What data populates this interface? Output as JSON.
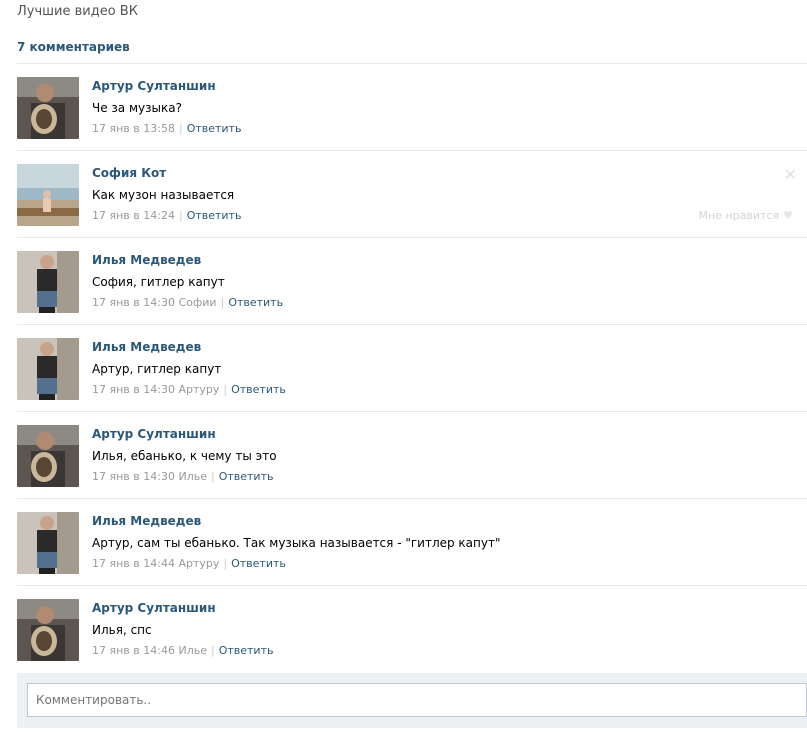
{
  "page_title": "Лучшие видео ВК",
  "comments_count": "7 комментариев",
  "reply_label": "Ответить",
  "comments": [
    {
      "author": "Артур Султаншин",
      "text": "Че за музыка?",
      "time": "17 янв в 13:58",
      "to": "",
      "avatar": "artur"
    },
    {
      "author": "София Кот",
      "text": "Как музон называется",
      "time": "17 янв в 14:24",
      "to": "",
      "avatar": "sofia",
      "hovered": true
    },
    {
      "author": "Илья Медведев",
      "text": "София, гитлер капут",
      "time": "17 янв в 14:30",
      "to": "Софии",
      "avatar": "ilya"
    },
    {
      "author": "Илья Медведев",
      "text": "Артур, гитлер капут",
      "time": "17 янв в 14:30",
      "to": "Артуру",
      "avatar": "ilya"
    },
    {
      "author": "Артур Султаншин",
      "text": "Илья, ебанько, к чему ты это",
      "time": "17 янв в 14:30",
      "to": "Илье",
      "avatar": "artur"
    },
    {
      "author": "Илья Медведев",
      "text": "Артур, сам ты ебанько. Так музыка называется - \"гитлер капут\"",
      "time": "17 янв в 14:44",
      "to": "Артуру",
      "avatar": "ilya"
    },
    {
      "author": "Артур Султаншин",
      "text": "Илья, спс",
      "time": "17 янв в 14:46",
      "to": "Илье",
      "avatar": "artur"
    }
  ],
  "like_label": "Мне нравится",
  "reply_placeholder": "Комментировать.."
}
